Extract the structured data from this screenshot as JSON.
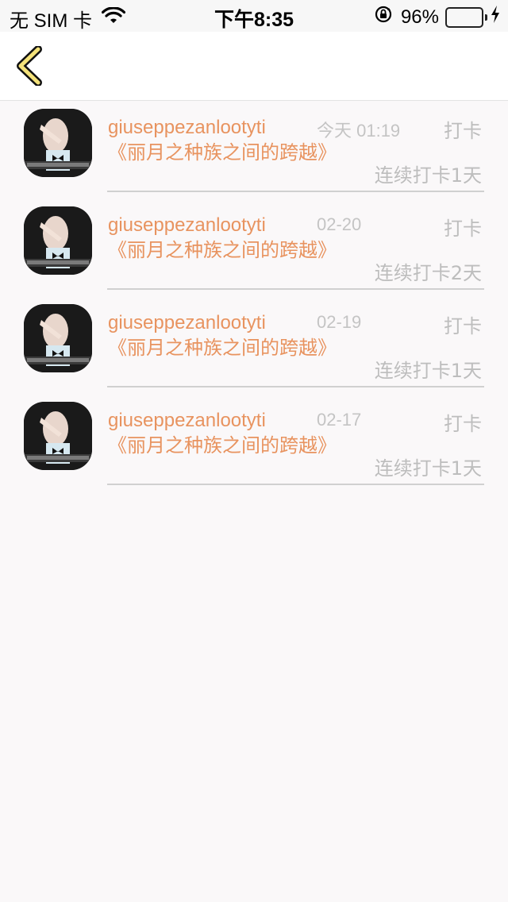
{
  "status_bar": {
    "carrier": "无 SIM 卡",
    "time": "下午8:35",
    "battery": "96%",
    "battery_level": 0.96
  },
  "nav": {
    "back_icon": "chevron-left-icon"
  },
  "records": [
    {
      "name": "giuseppezanlootyti",
      "time": "今天 01:19",
      "action": "打卡",
      "book": "《丽月之种族之间的跨越》",
      "streak": "连续打卡1天"
    },
    {
      "name": "giuseppezanlootyti",
      "time": "02-20",
      "action": "打卡",
      "book": "《丽月之种族之间的跨越》",
      "streak": "连续打卡2天"
    },
    {
      "name": "giuseppezanlootyti",
      "time": "02-19",
      "action": "打卡",
      "book": "《丽月之种族之间的跨越》",
      "streak": "连续打卡1天"
    },
    {
      "name": "giuseppezanlootyti",
      "time": "02-17",
      "action": "打卡",
      "book": "《丽月之种族之间的跨越》",
      "streak": "连续打卡1天"
    }
  ],
  "colors": {
    "accent": "#e8935f",
    "muted": "#bdbdbd",
    "back_icon_fill": "#f4e27a"
  }
}
